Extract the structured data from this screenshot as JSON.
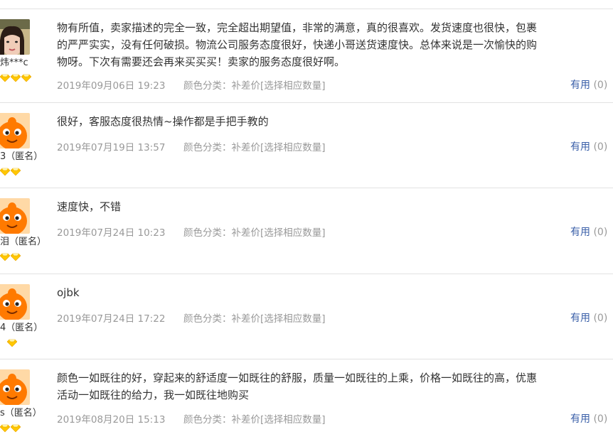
{
  "colors": {
    "link": "#3a5fa8",
    "meta": "#999999",
    "text": "#333333",
    "divider": "#e2e2e2",
    "diamond": "#ffc800",
    "avatar_orange": "#ff7a00"
  },
  "reviews": [
    {
      "avatar": "photo-avatar",
      "username": "炜***c",
      "rank_icons": 3,
      "content_lines": [
        "物有所值，卖家描述的完全一致，完全超出期望值，非常的满意，真的很喜欢。发货速度也很快，包裹",
        "的严严实实，没有任何破损。物流公司服务态度很好，快递小哥送货速度快。总体来说是一次愉快的购",
        "物呀。下次有需要还会再来买买买！卖家的服务态度很好啊。"
      ],
      "date": "2019年09月06日 19:23",
      "sku": "颜色分类：补差价[选择相应数量]",
      "useful_label": "有用",
      "useful_count": "(0)"
    },
    {
      "avatar": "default-avatar",
      "username": "3（匿名）",
      "rank_icons": 2,
      "content_lines": [
        "很好，客服态度很热情~操作都是手把手教的"
      ],
      "date": "2019年07月19日 13:57",
      "sku": "颜色分类：补差价[选择相应数量]",
      "useful_label": "有用",
      "useful_count": "(0)"
    },
    {
      "avatar": "default-avatar",
      "username": "泪（匿名）",
      "rank_icons": 2,
      "content_lines": [
        "速度快，不错"
      ],
      "date": "2019年07月24日 10:23",
      "sku": "颜色分类：补差价[选择相应数量]",
      "useful_label": "有用",
      "useful_count": "(0)"
    },
    {
      "avatar": "default-avatar",
      "username": "4（匿名）",
      "rank_icons": 1,
      "content_lines": [
        "ojbk"
      ],
      "date": "2019年07月24日 17:22",
      "sku": "颜色分类：补差价[选择相应数量]",
      "useful_label": "有用",
      "useful_count": "(0)"
    },
    {
      "avatar": "default-avatar",
      "username": "s（匿名）",
      "rank_icons": 2,
      "content_lines": [
        "颜色一如既往的好，穿起来的舒适度一如既往的舒服，质量一如既往的上乘，价格一如既往的高，优惠",
        "活动一如既往的给力，我一如既往地购买"
      ],
      "date": "2019年08月20日 15:13",
      "sku": "颜色分类：补差价[选择相应数量]",
      "useful_label": "有用",
      "useful_count": "(0)"
    }
  ]
}
